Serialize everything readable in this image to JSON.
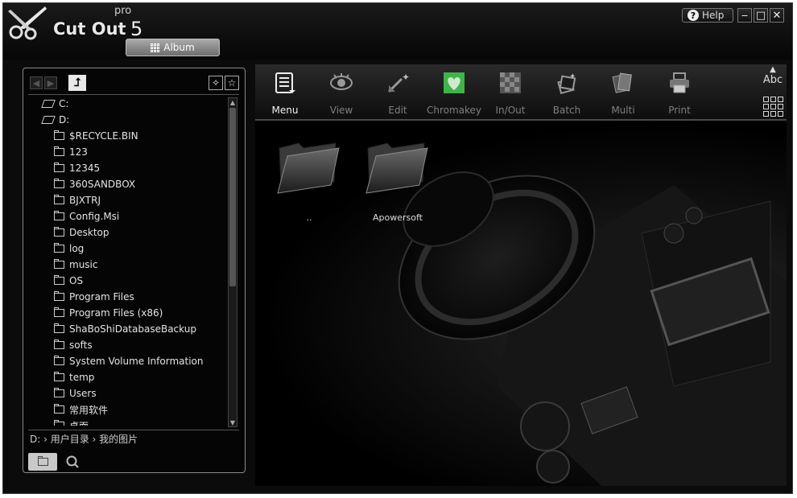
{
  "app": {
    "name": "Cut Out",
    "edition": "pro",
    "version": "5",
    "album_button": "Album",
    "help_button": "Help"
  },
  "window_controls": {
    "minimize": "‒",
    "maximize": "□",
    "close": "✕"
  },
  "sidebar": {
    "tree": [
      {
        "label": "C:",
        "type": "drive",
        "indent": 0
      },
      {
        "label": "D:",
        "type": "drive",
        "indent": 0
      },
      {
        "label": "$RECYCLE.BIN",
        "type": "folder",
        "indent": 1
      },
      {
        "label": "123",
        "type": "folder",
        "indent": 1
      },
      {
        "label": "12345",
        "type": "folder",
        "indent": 1
      },
      {
        "label": "360SANDBOX",
        "type": "folder",
        "indent": 1
      },
      {
        "label": "BJXTRJ",
        "type": "folder",
        "indent": 1
      },
      {
        "label": "Config.Msi",
        "type": "folder",
        "indent": 1
      },
      {
        "label": "Desktop",
        "type": "folder",
        "indent": 1
      },
      {
        "label": "log",
        "type": "folder",
        "indent": 1
      },
      {
        "label": "music",
        "type": "folder",
        "indent": 1
      },
      {
        "label": "OS",
        "type": "folder",
        "indent": 1
      },
      {
        "label": "Program Files",
        "type": "folder",
        "indent": 1
      },
      {
        "label": "Program Files (x86)",
        "type": "folder",
        "indent": 1
      },
      {
        "label": "ShaBoShiDatabaseBackup",
        "type": "folder",
        "indent": 1
      },
      {
        "label": "softs",
        "type": "folder",
        "indent": 1
      },
      {
        "label": "System Volume Information",
        "type": "folder",
        "indent": 1
      },
      {
        "label": "temp",
        "type": "folder",
        "indent": 1
      },
      {
        "label": "Users",
        "type": "folder",
        "indent": 1
      },
      {
        "label": "常用软件",
        "type": "folder",
        "indent": 1
      },
      {
        "label": "桌面",
        "type": "folder",
        "indent": 1
      }
    ],
    "path": "D: › 用户目录 › 我的图片"
  },
  "toolbar": {
    "tools": [
      {
        "label": "Menu",
        "icon": "menu-icon",
        "active": true
      },
      {
        "label": "View",
        "icon": "eye-icon",
        "active": false
      },
      {
        "label": "Edit",
        "icon": "wand-icon",
        "active": false
      },
      {
        "label": "Chromakey",
        "icon": "heart-icon",
        "active": false
      },
      {
        "label": "In/Out",
        "icon": "checker-icon",
        "active": false
      },
      {
        "label": "Batch",
        "icon": "stack-icon",
        "active": false
      },
      {
        "label": "Multi",
        "icon": "pages-icon",
        "active": false
      },
      {
        "label": "Print",
        "icon": "printer-icon",
        "active": false
      }
    ],
    "text_toggle": "Abc",
    "chromakey_color": "#3fb44a"
  },
  "content": {
    "items": [
      {
        "label": ".."
      },
      {
        "label": "Apowersoft"
      }
    ]
  }
}
